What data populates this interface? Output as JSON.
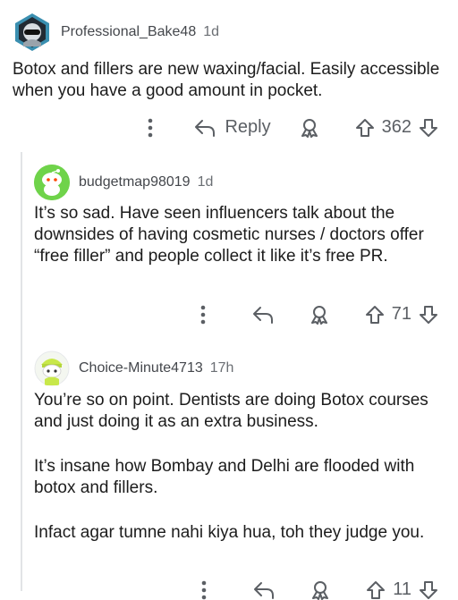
{
  "comments": [
    {
      "author": "Professional_Bake48",
      "age": "1d",
      "text": [
        "Botox and fillers are new waxing/facial. Easily accessible when you have a good amount in pocket."
      ],
      "reply_label": "Reply",
      "score": "362",
      "avatar_icon": "snoo-avatar-icon"
    },
    {
      "author": "budgetmap98019",
      "age": "1d",
      "text": [
        "It’s so sad. Have seen influencers talk about the downsides of having cosmetic nurses / doctors offer “free filler” and people collect it like it’s free PR."
      ],
      "score": "71",
      "avatar_icon": "snoo-avatar-icon"
    },
    {
      "author": "Choice-Minute4713",
      "age": "17h",
      "text": [
        "You’re so on point. Dentists are doing Botox courses and just doing it as an extra business.",
        "It’s insane how Bombay and Delhi are flooded with botox and fillers.",
        "Infact agar tumne nahi kiya hua, toh they judge you."
      ],
      "score": "11",
      "avatar_icon": "snoo-avatar-icon"
    }
  ],
  "colors": {
    "text": "#1c1c1c",
    "meta": "#6b6f74",
    "icon": "#5b5f64",
    "thread_line": "#e2e4e6",
    "avatar2_bg": "#6fd34a",
    "avatar3_bg": "#ffffff"
  }
}
